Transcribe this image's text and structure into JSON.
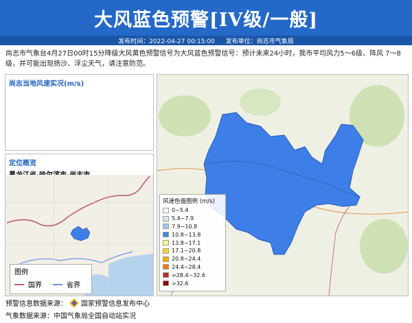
{
  "header": {
    "title": "大风蓝色预警[IV级/一般]",
    "publish_time_label": "发布时间：2022-04-27 00:15:00",
    "publish_unit_label": "发布单位：尚志市气象局"
  },
  "description": "尚志市气象台4月27日00时15分降级大风黄色预警信号为大风蓝色预警信号：预计未来24小时，我市平均风力5～6级、阵风 7～8级，并可能出现扬沙、浮尘天气，请注意防范。",
  "wind_panel": {
    "title": "尚志当地风速实况(m/s)"
  },
  "locator": {
    "title": "定位概览",
    "path": "黑龙江省-哈尔滨市-尚志市",
    "legend_title": "图例",
    "legend_items": [
      {
        "label": "国界",
        "color": "#c05a78"
      },
      {
        "label": "省界",
        "color": "#6f8fe0"
      }
    ]
  },
  "map_legend": {
    "title": "风速色值图例 (m/s)",
    "items": [
      {
        "label": "0~5.4",
        "color": "#ffffff"
      },
      {
        "label": "5.4~7.9",
        "color": "#d4e7f7"
      },
      {
        "label": "7.9~10.8",
        "color": "#9ec8f0"
      },
      {
        "label": "10.8~13.8",
        "color": "#3e86e0"
      },
      {
        "label": "13.8~17.1",
        "color": "#fff68a"
      },
      {
        "label": "17.1~20.8",
        "color": "#ffd42a"
      },
      {
        "label": "20.8~24.4",
        "color": "#ffaa00"
      },
      {
        "label": "24.4~28.4",
        "color": "#ff7a00"
      },
      {
        "label": ">28.4~32.6",
        "color": "#c42828"
      },
      {
        "label": ">32.6",
        "color": "#8b0000"
      }
    ]
  },
  "region_color": "#3d7fe6",
  "footer": {
    "warning_source": "预警信息数据来源：",
    "warning_source_org": "国家预警信息发布中心",
    "weather_source": "气象数据来源：中国气象局全国自动站实况"
  }
}
